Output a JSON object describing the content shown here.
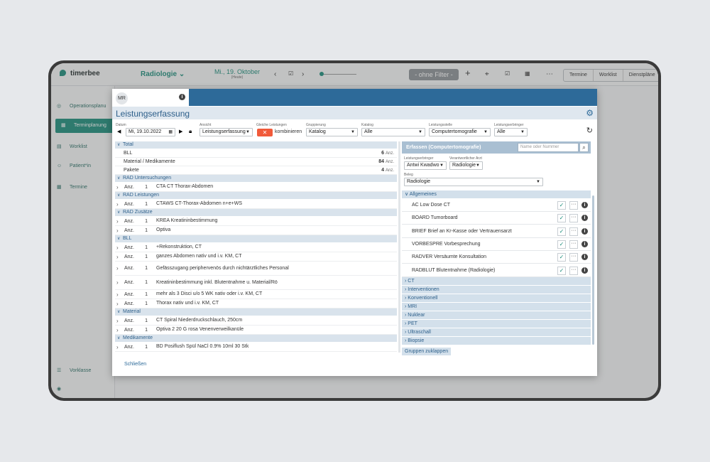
{
  "app": {
    "name": "timerbee",
    "department": "Radiologie",
    "date": "Mi., 19. Oktober",
    "date_sub": "(Heute)",
    "filter_label": "- ohne Filter -",
    "view_tabs": [
      "Termine",
      "Worklist",
      "Dienstpläne"
    ]
  },
  "sidebar": {
    "items": [
      {
        "label": "Operationsplanu"
      },
      {
        "label": "Terminplanung"
      },
      {
        "label": "Worklist"
      },
      {
        "label": "Patient*in"
      },
      {
        "label": "Termine"
      }
    ],
    "bottom": "Vorklasse"
  },
  "modal": {
    "avatar": "MR",
    "title": "Leistungserfassung",
    "filters": {
      "datum_label": "Datum",
      "datum_value": "Mi, 19.10.2022",
      "ansicht_label": "Ansicht",
      "ansicht_value": "Leistungserfassung",
      "gleiche_label": "Gleiche Leistungen",
      "kombinieren": "kombinieren",
      "gruppierung_label": "Gruppierung",
      "gruppierung_value": "Katalog",
      "katalog_label": "Katalog",
      "katalog_value": "Alle",
      "leistungsstelle_label": "Leistungsstelle",
      "leistungsstelle_value": "Computertomografie",
      "leistungserbringer_label": "Leistungserbringer",
      "leistungserbringer_value": "Alle"
    },
    "total": {
      "header": "Total",
      "rows": [
        {
          "label": "BLL",
          "value": "6",
          "unit": "Anz."
        },
        {
          "label": "Material / Medikamente",
          "value": "84",
          "unit": "Anz."
        },
        {
          "label": "Pakete",
          "value": "4",
          "unit": "Anz."
        }
      ]
    },
    "sections": [
      {
        "header": "RAD Untersuchungen",
        "rows": [
          {
            "anz": "Anz.",
            "qty": "1",
            "desc": "CTA CT Thorax-Abdomen"
          }
        ]
      },
      {
        "header": "RAD Leistungen",
        "rows": [
          {
            "anz": "Anz.",
            "qty": "1",
            "desc": "CTAWS CT-Thorax-Abdomen n+e+WS"
          }
        ]
      },
      {
        "header": "RAD Zusätze",
        "rows": [
          {
            "anz": "Anz.",
            "qty": "1",
            "desc": "KREA Kreatininbestimmung"
          },
          {
            "anz": "Anz.",
            "qty": "1",
            "desc": "Optiva"
          }
        ]
      },
      {
        "header": "BLL",
        "rows": [
          {
            "anz": "Anz.",
            "qty": "1",
            "desc": "+Rekonstruktion, CT"
          },
          {
            "anz": "Anz.",
            "qty": "1",
            "desc": "ganzes Abdomen nativ und i.v. KM, CT"
          },
          {
            "anz": "Anz.",
            "qty": "1",
            "desc": "Gefässzugang peripher­venös durch nichtärztliches Personal"
          },
          {
            "anz": "Anz.",
            "qty": "1",
            "desc": "Kreatininbestimmung inkl. Blutentnahme u. Material/Rö"
          },
          {
            "anz": "Anz.",
            "qty": "1",
            "desc": "mehr als 3 Disci u/o 5 WK nativ oder i.v. KM, CT"
          },
          {
            "anz": "Anz.",
            "qty": "1",
            "desc": "Thorax nativ und i.v. KM, CT"
          }
        ]
      },
      {
        "header": "Material",
        "rows": [
          {
            "anz": "Anz.",
            "qty": "1",
            "desc": "CT Spiral Niederdruckschlauch, 250cm"
          },
          {
            "anz": "Anz.",
            "qty": "1",
            "desc": "Optiva 2 20 G rosa Venenverweilkanüle"
          }
        ]
      },
      {
        "header": "Medikamente",
        "rows": [
          {
            "anz": "Anz.",
            "qty": "1",
            "desc": "BD Posiflush Spül NaCl 0.9% 10ml 30 Stk"
          }
        ]
      }
    ],
    "right": {
      "header": "Erfassen (Computertomografie)",
      "search_placeholder": "Name oder Nummer",
      "leistungserbringer_label": "Leistungserbringer",
      "leistungserbringer_value": "Antwi Kwadwo",
      "verantwortlicher_label": "Verantwortlicher Arzt",
      "verantwortlicher_value": "Radiologie",
      "beleg_label": "Beleg",
      "beleg_value": "Radiologie",
      "open_category": "Allgemeines",
      "services": [
        {
          "label": "AC Low Dose CT"
        },
        {
          "label": "BOARD Tumorboard"
        },
        {
          "label": "BRIEF Brief an Kr-Kasse oder Vertrauensarzt"
        },
        {
          "label": "VORBESPRE Vorbesprechung"
        },
        {
          "label": "RADVER Versäumte Konsultation"
        },
        {
          "label": "RADBLUT Blutentnahme (Radiologie)"
        }
      ],
      "categories": [
        "CT",
        "Interventionen",
        "Konventionell",
        "MRI",
        "Nuklear",
        "PET",
        "Ultraschall",
        "Biopsie"
      ],
      "collapse": "Gruppen zuklappen"
    },
    "close": "Schließen"
  }
}
